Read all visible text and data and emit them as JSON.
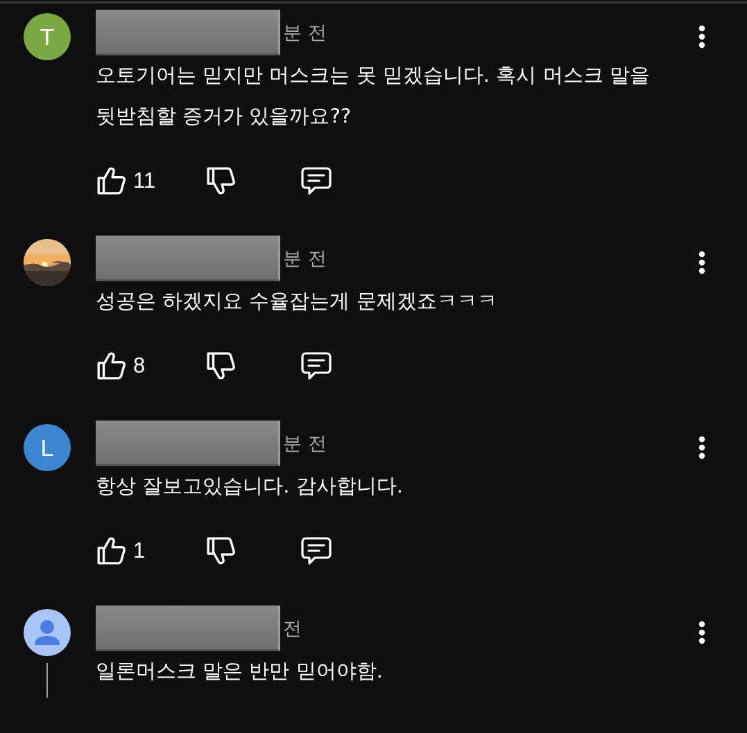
{
  "comments": [
    {
      "avatar": {
        "kind": "letter",
        "letter": "T",
        "color": "#7aa944"
      },
      "time": "분 전",
      "text": "오토기어는 믿지만 머스크는 못 믿겠습니다. 혹시 머스크 말을 뒷받침할 증거가 있을까요??",
      "likes": "11"
    },
    {
      "time": "분 전",
      "text": "성공은 하겠지요 수율잡는게 문제겠죠ㅋㅋㅋ",
      "likes": "8"
    },
    {
      "avatar": {
        "kind": "letter",
        "letter": "L",
        "color": "#3d86d1"
      },
      "time": "분 전",
      "text": "항상 잘보고있습니다. 감사합니다.",
      "likes": "1"
    },
    {
      "avatar": {
        "kind": "silhouette"
      },
      "time": "전",
      "text": "일론머스크 말은 반만 믿어야함.",
      "thread_line": true
    }
  ]
}
